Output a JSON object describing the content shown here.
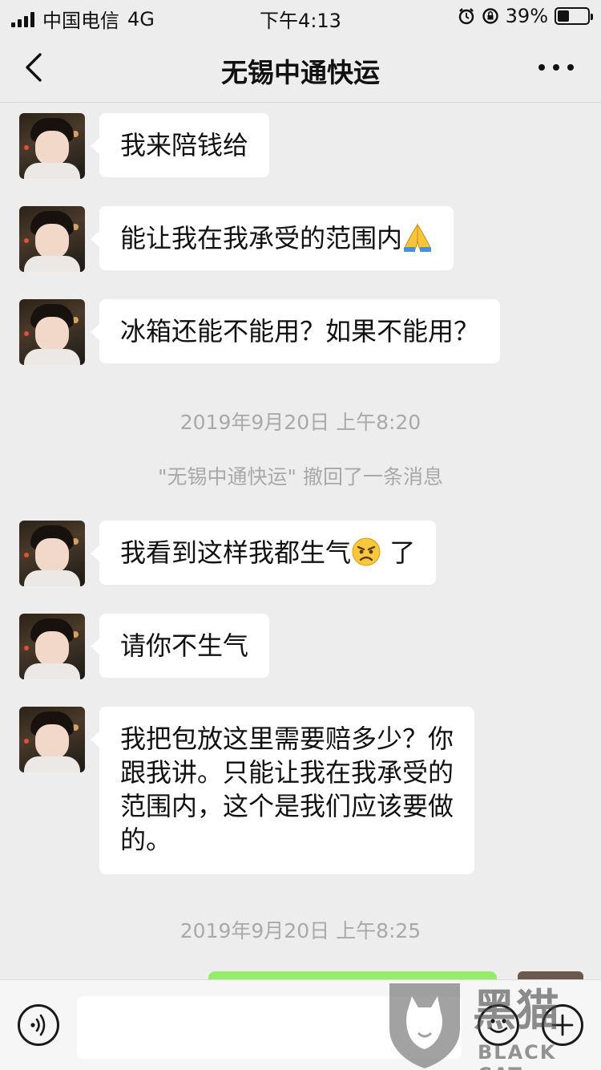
{
  "status_bar": {
    "carrier": "中国电信",
    "network": "4G",
    "time": "下午4:13",
    "battery": "39%",
    "battery_level": 0.39
  },
  "nav": {
    "title": "无锡中通快运",
    "back_icon": "chevron-left-icon",
    "more_icon": "more-dots-icon"
  },
  "messages": [
    {
      "text": "我来陪钱给"
    },
    {
      "text": "能让我在我承受的范围内",
      "emoji": "folded-hands"
    },
    {
      "text": "冰箱还能不能用？如果不能用？"
    },
    {
      "timestamp": "2019年9月20日 上午8:20"
    },
    {
      "system": "\"无锡中通快运\" 撤回了一条消息"
    },
    {
      "text": "我看到这样我都生气",
      "emoji": "angry-face",
      "text_after": " 了"
    },
    {
      "text": "请你不生气"
    },
    {
      "lines": [
        "我把包放这里需要赔多少？你",
        "跟我讲。只能让我在我承受的",
        "范围内，这个是我们应该要做",
        "的。"
      ]
    },
    {
      "timestamp": "2019年9月20日 上午8:25"
    }
  ],
  "input_bar": {
    "voice_icon": "voice-icon",
    "emoji_icon": "emoji-icon",
    "plus_icon": "plus-icon"
  },
  "watermark": {
    "text": "BLACK CAT",
    "logo_text": "黑猫"
  },
  "colors": {
    "background": "#ededed",
    "bubble_received": "#ffffff",
    "bubble_sent": "#95ec69",
    "muted_text": "#a9a9a9"
  }
}
